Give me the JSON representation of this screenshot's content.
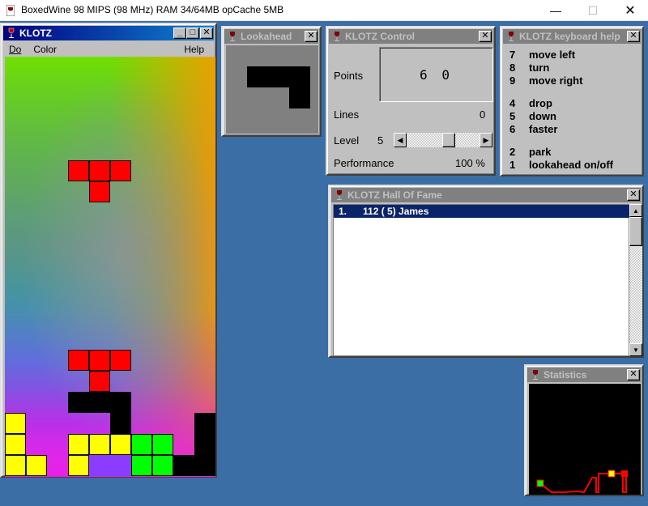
{
  "host": {
    "title": "BoxedWine 98 MIPS (98 MHz) RAM 34/64MB opCache 5MB",
    "minimize": "—",
    "maximize": "☐",
    "close": "✕"
  },
  "klotz": {
    "title": "KLOTZ",
    "menu": {
      "do": "Do",
      "color": "Color",
      "help": "Help"
    }
  },
  "lookahead": {
    "title": "Lookahead"
  },
  "control": {
    "title": "KLOTZ Control",
    "points_label": "Points",
    "points_value": "6 0",
    "lines_label": "Lines",
    "lines_value": "0",
    "level_label": "Level",
    "level_value": "5",
    "level_slider_fraction": 0.6,
    "performance_label": "Performance",
    "performance_value": "100 %"
  },
  "keyhelp": {
    "title": "KLOTZ keyboard help",
    "keys": [
      {
        "key": "7",
        "action": "move left"
      },
      {
        "key": "8",
        "action": "turn"
      },
      {
        "key": "9",
        "action": "move right"
      },
      {
        "key": "4",
        "action": "drop"
      },
      {
        "key": "5",
        "action": "down"
      },
      {
        "key": "6",
        "action": "faster"
      },
      {
        "key": "2",
        "action": "park"
      },
      {
        "key": "1",
        "action": "lookahead on/off"
      }
    ]
  },
  "hof": {
    "title": "KLOTZ Hall Of Fame",
    "entries": [
      {
        "text": "1.      112 ( 5) James"
      }
    ]
  },
  "stats": {
    "title": "Statistics"
  },
  "colors": {
    "desktop": "#3a6ea5",
    "piece_red": "#ff0000",
    "piece_yellow": "#ffff00",
    "piece_green": "#00ff00",
    "title_active": "#000080",
    "title_inactive": "#808080"
  }
}
